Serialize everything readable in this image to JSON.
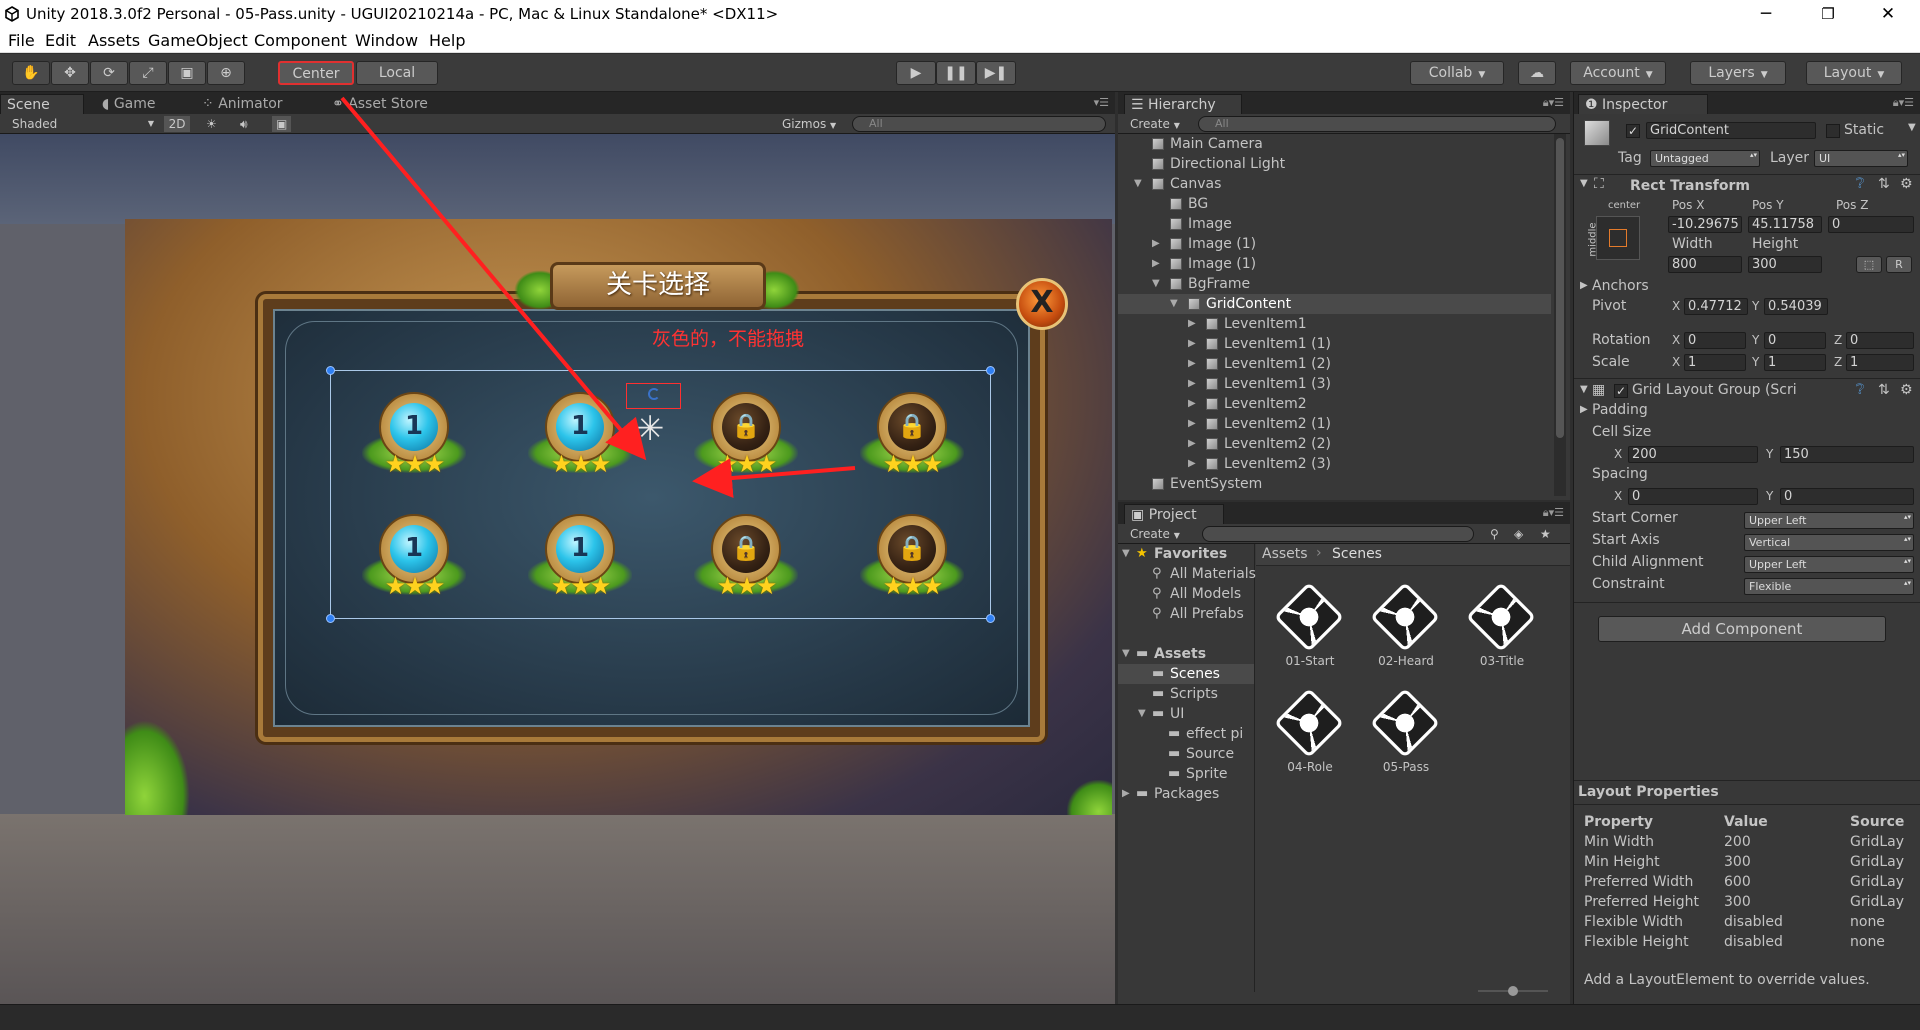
{
  "window": {
    "title": "Unity 2018.3.0f2 Personal - 05-Pass.unity - UGUI20210214a - PC, Mac & Linux Standalone* <DX11>",
    "minimize": "─",
    "maximize": "❐",
    "close": "✕"
  },
  "menu": [
    "File",
    "Edit",
    "Assets",
    "GameObject",
    "Component",
    "Window",
    "Help"
  ],
  "toolbar": {
    "pivot_center": "Center",
    "pivot_local": "Local",
    "collab": "Collab",
    "account": "Account",
    "layers": "Layers",
    "layout": "Layout",
    "play": "▶",
    "pause": "❚❚",
    "step": "▶❚"
  },
  "scene_panel": {
    "tabs": [
      "Scene",
      "Game",
      "Animator",
      "Asset Store"
    ],
    "shading": "Shaded",
    "mode_2d": "2D",
    "gizmos": "Gizmos",
    "search_placeholder": "All"
  },
  "game": {
    "banner_text": "关卡选择",
    "note_text": "灰色的，不能拖拽",
    "close_glyph": "X",
    "levels": [
      {
        "state": "open",
        "label": "1",
        "stars": "★★★"
      },
      {
        "state": "open",
        "label": "1",
        "stars": "★★★"
      },
      {
        "state": "lock",
        "label": "🔒",
        "stars": "★★★"
      },
      {
        "state": "lock",
        "label": "🔒",
        "stars": "★★★"
      },
      {
        "state": "open",
        "label": "1",
        "stars": "★★★"
      },
      {
        "state": "open",
        "label": "1",
        "stars": "★★★"
      },
      {
        "state": "lock",
        "label": "🔒",
        "stars": "★★★"
      },
      {
        "state": "lock",
        "label": "🔒",
        "stars": "★★★"
      }
    ]
  },
  "hierarchy": {
    "title": "Hierarchy",
    "create": "Create",
    "search_placeholder": "All",
    "items": [
      "Main Camera",
      "Directional Light",
      "Canvas",
      "BG",
      "Image",
      "Image (1)",
      "Image (1)",
      "BgFrame",
      "GridContent",
      "LevenItem1",
      "LevenItem1 (1)",
      "LevenItem1 (2)",
      "LevenItem1 (3)",
      "LevenItem2",
      "LevenItem2 (1)",
      "LevenItem2 (2)",
      "LevenItem2 (3)",
      "EventSystem"
    ]
  },
  "project": {
    "title": "Project",
    "create": "Create",
    "breadcrumb": [
      "Assets",
      "Scenes"
    ],
    "tree": [
      "Favorites",
      "All Materials",
      "All Models",
      "All Prefabs",
      "Assets",
      "Scenes",
      "Scripts",
      "UI",
      "effect pi",
      "Source",
      "Sprite",
      "Packages"
    ],
    "assets": [
      "01-Start",
      "02-Heard",
      "03-Title",
      "04-Role",
      "05-Pass"
    ]
  },
  "inspector": {
    "title": "Inspector",
    "object_name": "GridContent",
    "static": "Static",
    "tag_label": "Tag",
    "tag_value": "Untagged",
    "layer_label": "Layer",
    "layer_value": "UI",
    "rect": {
      "title": "Rect Transform",
      "anchor_h": "center",
      "anchor_v": "middle",
      "posx_label": "Pos X",
      "posy_label": "Pos Y",
      "posz_label": "Pos Z",
      "posx": "-10.29675",
      "posy": "45.11758",
      "posz": "0",
      "width_label": "Width",
      "height_label": "Height",
      "width": "800",
      "height": "300",
      "r_btn": "R",
      "anchors": "Anchors",
      "pivot": "Pivot",
      "pivot_x": "0.47712",
      "pivot_y": "0.54039",
      "rotation": "Rotation",
      "rot_x": "0",
      "rot_y": "0",
      "rot_z": "0",
      "scale": "Scale",
      "scale_x": "1",
      "scale_y": "1",
      "scale_z": "1"
    },
    "grid": {
      "title": "Grid Layout Group (Scri",
      "padding": "Padding",
      "cell_size": "Cell Size",
      "cell_x": "200",
      "cell_y": "150",
      "spacing": "Spacing",
      "sp_x": "0",
      "sp_y": "0",
      "start_corner": "Start Corner",
      "start_corner_val": "Upper Left",
      "start_axis": "Start Axis",
      "start_axis_val": "Vertical",
      "child_alignment": "Child Alignment",
      "child_alignment_val": "Upper Left",
      "constraint": "Constraint",
      "constraint_val": "Flexible"
    },
    "add_component": "Add Component",
    "layout_props": {
      "title": "Layout Properties",
      "headers": [
        "Property",
        "Value",
        "Source"
      ],
      "rows": [
        [
          "Min Width",
          "200",
          "GridLay"
        ],
        [
          "Min Height",
          "300",
          "GridLay"
        ],
        [
          "Preferred Width",
          "600",
          "GridLay"
        ],
        [
          "Preferred Height",
          "300",
          "GridLay"
        ],
        [
          "Flexible Width",
          "disabled",
          "none"
        ],
        [
          "Flexible Height",
          "disabled",
          "none"
        ]
      ],
      "footer": "Add a LayoutElement to override values."
    }
  }
}
